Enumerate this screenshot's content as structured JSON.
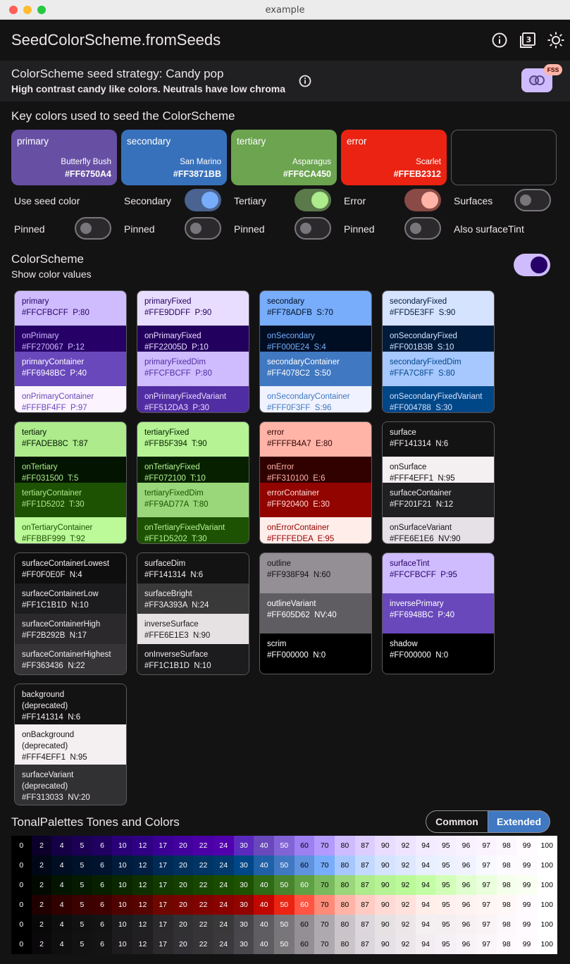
{
  "window": {
    "title": "example"
  },
  "appbar": {
    "title": "SeedColorScheme.fromSeeds",
    "icons": [
      "info-icon",
      "theme-3-icon",
      "brightness-icon"
    ]
  },
  "strategy": {
    "title": "ColorScheme seed strategy: Candy pop",
    "subtitle": "High contrast candy like colors. Neutrals have low chroma",
    "badge": "FSS"
  },
  "key_colors": {
    "heading": "Key colors used to seed the ColorScheme",
    "seeds": [
      {
        "name": "primary",
        "color_name": "Butterfly Bush",
        "hex": "#FF6750A4",
        "bg": "#6750A4"
      },
      {
        "name": "secondary",
        "color_name": "San Marino",
        "hex": "#FF3871BB",
        "bg": "#3871BB"
      },
      {
        "name": "tertiary",
        "color_name": "Asparagus",
        "hex": "#FF6CA450",
        "bg": "#6CA450"
      },
      {
        "name": "error",
        "color_name": "Scarlet",
        "hex": "#FFEB2312",
        "bg": "#EB2312"
      }
    ],
    "row1": [
      "Use seed color",
      "Secondary",
      "Tertiary",
      "Error",
      "Surfaces"
    ],
    "row2": [
      "Pinned",
      "Pinned",
      "Pinned",
      "Pinned",
      "Also surfaceTint"
    ]
  },
  "scheme": {
    "heading": "ColorScheme",
    "subheading": "Show color values"
  },
  "cards": [
    [
      {
        "name": "primary",
        "value": "#FFCFBCFF  P:80",
        "bg": "#CFBCFF",
        "fg": "#270067"
      },
      {
        "name": "onPrimary",
        "value": "#FF270067  P:12",
        "bg": "#270067",
        "fg": "#CFBCFF"
      },
      {
        "name": "primaryContainer",
        "value": "#FF6948BC  P:40",
        "bg": "#6948BC",
        "fg": "#FFFFFF"
      },
      {
        "name": "onPrimaryContainer",
        "value": "#FFFBF4FF  P:97",
        "bg": "#FBF4FF",
        "fg": "#6948BC"
      }
    ],
    [
      {
        "name": "primaryFixed",
        "value": "#FFE9DDFF  P:90",
        "bg": "#E9DDFF",
        "fg": "#22005D"
      },
      {
        "name": "onPrimaryFixed",
        "value": "#FF22005D  P:10",
        "bg": "#22005D",
        "fg": "#E9DDFF"
      },
      {
        "name": "primaryFixedDim",
        "value": "#FFCFBCFF  P:80",
        "bg": "#CFBCFF",
        "fg": "#512DA3"
      },
      {
        "name": "onPrimaryFixedVariant",
        "value": "#FF512DA3  P:30",
        "bg": "#512DA3",
        "fg": "#E9DDFF"
      }
    ],
    [
      {
        "name": "secondary",
        "value": "#FF78ADFB  S:70",
        "bg": "#78ADFB",
        "fg": "#000E24"
      },
      {
        "name": "onSecondary",
        "value": "#FF000E24  S:4",
        "bg": "#000E24",
        "fg": "#78ADFB"
      },
      {
        "name": "secondaryContainer",
        "value": "#FF4078C2  S:50",
        "bg": "#4078C2",
        "fg": "#FFFFFF"
      },
      {
        "name": "onSecondaryContainer",
        "value": "#FFF0F3FF  S:96",
        "bg": "#F0F3FF",
        "fg": "#4078C2"
      }
    ],
    [
      {
        "name": "secondaryFixed",
        "value": "#FFD5E3FF  S:90",
        "bg": "#D5E3FF",
        "fg": "#001B3B"
      },
      {
        "name": "onSecondaryFixed",
        "value": "#FF001B3B  S:10",
        "bg": "#001B3B",
        "fg": "#D5E3FF"
      },
      {
        "name": "secondaryFixedDim",
        "value": "#FFA7C8FF  S:80",
        "bg": "#A7C8FF",
        "fg": "#004788"
      },
      {
        "name": "onSecondaryFixedVariant",
        "value": "#FF004788  S:30",
        "bg": "#004788",
        "fg": "#D5E3FF"
      }
    ],
    [
      {
        "name": "tertiary",
        "value": "#FFADEB8C  T:87",
        "bg": "#ADEB8C",
        "fg": "#031500"
      },
      {
        "name": "onTertiary",
        "value": "#FF031500  T:5",
        "bg": "#031500",
        "fg": "#ADEB8C"
      },
      {
        "name": "tertiaryContainer",
        "value": "#FF1D5202  T:30",
        "bg": "#1D5202",
        "fg": "#ADEB8C"
      },
      {
        "name": "onTertiaryContainer",
        "value": "#FFBBF999  T:92",
        "bg": "#BBF999",
        "fg": "#1D5202"
      }
    ],
    [
      {
        "name": "tertiaryFixed",
        "value": "#FFB5F394  T:90",
        "bg": "#B5F394",
        "fg": "#072100"
      },
      {
        "name": "onTertiaryFixed",
        "value": "#FF072100  T:10",
        "bg": "#072100",
        "fg": "#B5F394"
      },
      {
        "name": "tertiaryFixedDim",
        "value": "#FF9AD77A  T:80",
        "bg": "#9AD77A",
        "fg": "#1D5202"
      },
      {
        "name": "onTertiaryFixedVariant",
        "value": "#FF1D5202  T:30",
        "bg": "#1D5202",
        "fg": "#B5F394"
      }
    ],
    [
      {
        "name": "error",
        "value": "#FFFFB4A7  E:80",
        "bg": "#FFB4A7",
        "fg": "#310100"
      },
      {
        "name": "onError",
        "value": "#FF310100  E:6",
        "bg": "#310100",
        "fg": "#FFB4A7"
      },
      {
        "name": "errorContainer",
        "value": "#FF920400  E:30",
        "bg": "#920400",
        "fg": "#FFDAD4"
      },
      {
        "name": "onErrorContainer",
        "value": "#FFFFEDEA  E:95",
        "bg": "#FFEDEA",
        "fg": "#920400"
      }
    ],
    [
      {
        "name": "surface",
        "value": "#FF141314  N:6",
        "bg": "#141314",
        "fg": "#F4EFF1"
      },
      {
        "name": "onSurface",
        "value": "#FFF4EFF1  N:95",
        "bg": "#F4EFF1",
        "fg": "#141314"
      },
      {
        "name": "surfaceContainer",
        "value": "#FF201F21  N:12",
        "bg": "#201F21",
        "fg": "#F4EFF1"
      },
      {
        "name": "onSurfaceVariant",
        "value": "#FFE6E1E6  NV:90",
        "bg": "#E6E1E6",
        "fg": "#141314"
      }
    ],
    [
      {
        "name": "surfaceContainerLowest",
        "value": "#FF0F0E0F  N:4",
        "bg": "#0F0E0F",
        "fg": "#F4EFF1"
      },
      {
        "name": "surfaceContainerLow",
        "value": "#FF1C1B1D  N:10",
        "bg": "#1C1B1D",
        "fg": "#F4EFF1"
      },
      {
        "name": "surfaceContainerHigh",
        "value": "#FF2B292B  N:17",
        "bg": "#2B292B",
        "fg": "#F4EFF1"
      },
      {
        "name": "surfaceContainerHighest",
        "value": "#FF363436  N:22",
        "bg": "#363436",
        "fg": "#F4EFF1"
      }
    ],
    [
      {
        "name": "surfaceDim",
        "value": "#FF141314  N:6",
        "bg": "#141314",
        "fg": "#F4EFF1"
      },
      {
        "name": "surfaceBright",
        "value": "#FF3A393A  N:24",
        "bg": "#3A393A",
        "fg": "#F4EFF1"
      },
      {
        "name": "inverseSurface",
        "value": "#FFE6E1E3  N:90",
        "bg": "#E6E1E3",
        "fg": "#1C1B1D"
      },
      {
        "name": "onInverseSurface",
        "value": "#FF1C1B1D  N:10",
        "bg": "#1C1B1D",
        "fg": "#F4EFF1"
      }
    ],
    [
      {
        "name": "outline",
        "value": "#FF938F94  N:60",
        "bg": "#938F94",
        "fg": "#141314"
      },
      {
        "name": "outlineVariant",
        "value": "#FF605D62  NV:40",
        "bg": "#605D62",
        "fg": "#FFFFFF"
      },
      {
        "name": "scrim",
        "value": "#FF000000  N:0",
        "bg": "#000000",
        "fg": "#FFFFFF"
      }
    ],
    [
      {
        "name": "surfaceTint",
        "value": "#FFCFBCFF  P:95",
        "bg": "#CFBCFF",
        "fg": "#270067"
      },
      {
        "name": "inversePrimary",
        "value": "#FF6948BC  P:40",
        "bg": "#6948BC",
        "fg": "#FFFFFF"
      },
      {
        "name": "shadow",
        "value": "#FF000000  N:0",
        "bg": "#000000",
        "fg": "#FFFFFF"
      }
    ],
    [
      {
        "name": "background\n(deprecated)",
        "value": "#FF141314  N:6",
        "bg": "#141314",
        "fg": "#F4EFF1"
      },
      {
        "name": "onBackground\n(deprecated)",
        "value": "#FFF4EFF1  N:95",
        "bg": "#F4EFF1",
        "fg": "#141314"
      },
      {
        "name": "surfaceVariant\n(deprecated)",
        "value": "#FF313033  NV:20",
        "bg": "#313033",
        "fg": "#F4EFF1"
      }
    ]
  ],
  "tonal": {
    "heading": "TonalPalettes Tones and Colors",
    "toggle": [
      "Common",
      "Extended"
    ],
    "selected": "Extended",
    "tones": [
      "0",
      "2",
      "4",
      "5",
      "6",
      "10",
      "12",
      "17",
      "20",
      "22",
      "24",
      "30",
      "40",
      "50",
      "60",
      "70",
      "80",
      "87",
      "90",
      "92",
      "94",
      "95",
      "96",
      "97",
      "98",
      "99",
      "100"
    ],
    "rows": [
      [
        "#000000",
        "#0B0029",
        "#150046",
        "#1B0054",
        "#200061",
        "#2A0079",
        "#300084",
        "#3A0096",
        "#42009E",
        "#4A00A6",
        "#5100AE",
        "#5A2ABE",
        "#6948BC",
        "#8263D6",
        "#9D7FF2",
        "#B49AFF",
        "#CFBCFF",
        "#DDCDFF",
        "#E9DDFF",
        "#EEE4FF",
        "#F3EBFF",
        "#F5EEFF",
        "#F8F1FF",
        "#FBF4FF",
        "#FCF7FF",
        "#FFFBFF",
        "#FFFFFF"
      ],
      [
        "#000000",
        "#000818",
        "#000E24",
        "#00112A",
        "#001430",
        "#001B3B",
        "#001F43",
        "#002A56",
        "#00315E",
        "#003566",
        "#00396D",
        "#004788",
        "#1F60A7",
        "#4078C2",
        "#5F93DE",
        "#78ADFB",
        "#A7C8FF",
        "#C4D9FF",
        "#D5E3FF",
        "#DDE8FF",
        "#E8EFFF",
        "#ECF1FF",
        "#F0F3FF",
        "#F8F9FF",
        "#FDFBFF",
        "#FEFBFF",
        "#FFFFFF"
      ],
      [
        "#000000",
        "#010900",
        "#031500",
        "#051A00",
        "#072100",
        "#0A2700",
        "#0E3000",
        "#113900",
        "#133F00",
        "#164600",
        "#1A4C00",
        "#1D5202",
        "#2F6B17",
        "#48842E",
        "#60A045",
        "#7ABA5E",
        "#9AD77A",
        "#ADEB8C",
        "#B5F394",
        "#BBF999",
        "#C3FEA5",
        "#D1FFB8",
        "#E0FFCF",
        "#EAFFDC",
        "#F4FFEC",
        "#F9FFF1",
        "#FFFFFF"
      ],
      [
        "#000000",
        "#200000",
        "#310100",
        "#3A0200",
        "#410000",
        "#4F0300",
        "#570400",
        "#6E0700",
        "#780400",
        "#800300",
        "#8A0200",
        "#920400",
        "#C00800",
        "#EB2312",
        "#FF5542",
        "#FF8A78",
        "#FFB4A7",
        "#FFCBC2",
        "#FFDAD4",
        "#FFE2DC",
        "#FFEDEA",
        "#FFF0EE",
        "#FFF3F1",
        "#FFF5F4",
        "#FFF8F7",
        "#FFFBFF",
        "#FFFFFF"
      ],
      [
        "#000000",
        "#090809",
        "#0F0E0F",
        "#121112",
        "#141314",
        "#1C1B1D",
        "#201F21",
        "#2B292B",
        "#313033",
        "#363436",
        "#3A393A",
        "#48464A",
        "#605D62",
        "#79767B",
        "#938F94",
        "#AEA9AF",
        "#CAC4CA",
        "#DCD7DC",
        "#E6E1E3",
        "#ECE6E9",
        "#F4EFF1",
        "#F4EFF1",
        "#F7F1F4",
        "#FAF4F7",
        "#FDF8FB",
        "#FFFBFF",
        "#FFFFFF"
      ],
      [
        "#000000",
        "#0A080A",
        "#100F10",
        "#131213",
        "#151415",
        "#1D1B1E",
        "#211F22",
        "#2C2A2D",
        "#323034",
        "#363437",
        "#3B393C",
        "#49474B",
        "#605D62",
        "#797679",
        "#938F94",
        "#AEA9AE",
        "#CAC4C9",
        "#DBD6DB",
        "#E6E1E6",
        "#EDE7EC",
        "#F3EDF2",
        "#F5F0F5",
        "#F8F3F7",
        "#FBF6FA",
        "#FEF9FD",
        "#FFFBFF",
        "#FFFFFF"
      ]
    ]
  }
}
